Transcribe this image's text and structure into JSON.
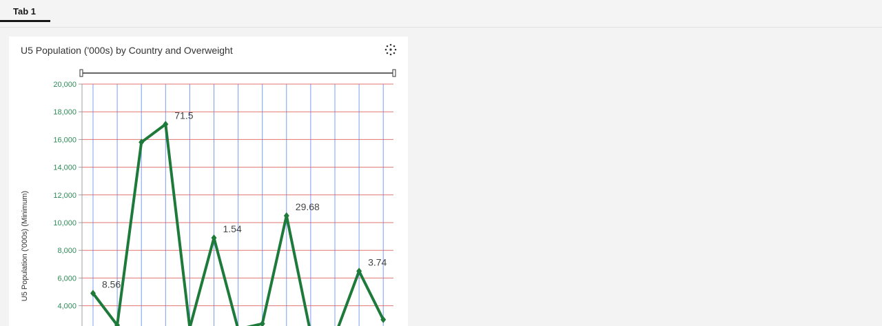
{
  "tabs": [
    {
      "label": "Tab 1"
    }
  ],
  "widget": {
    "title": "U5 Population ('000s) by Country and Overweight",
    "menu_icon": "scatter-dots-icon"
  },
  "colors": {
    "line": "#1e7a3a",
    "hgrid": "#d9534f",
    "vgrid": "#4d7cf5",
    "tick": "#2e8b57"
  },
  "chart_data": {
    "type": "line",
    "ylabel": "U5 Population ('000s) (Minimum)",
    "ylim": [
      0,
      20000
    ],
    "yticks": [
      4000,
      6000,
      8000,
      10000,
      12000,
      14000,
      16000,
      18000,
      20000
    ],
    "ytick_labels": [
      "4,000",
      "6,000",
      "8,000",
      "10,000",
      "12,000",
      "14,000",
      "16,000",
      "18,000",
      "20,000"
    ],
    "x_count": 13,
    "values": [
      4900,
      2600,
      15800,
      17100,
      2400,
      8900,
      2300,
      2700,
      10500,
      2000,
      1800,
      6500,
      3000
    ],
    "data_labels": [
      {
        "index": 0,
        "text": "8.56"
      },
      {
        "index": 3,
        "text": "71.5"
      },
      {
        "index": 5,
        "text": "1.54"
      },
      {
        "index": 8,
        "text": "29.68"
      },
      {
        "index": 11,
        "text": "3.74"
      }
    ]
  }
}
